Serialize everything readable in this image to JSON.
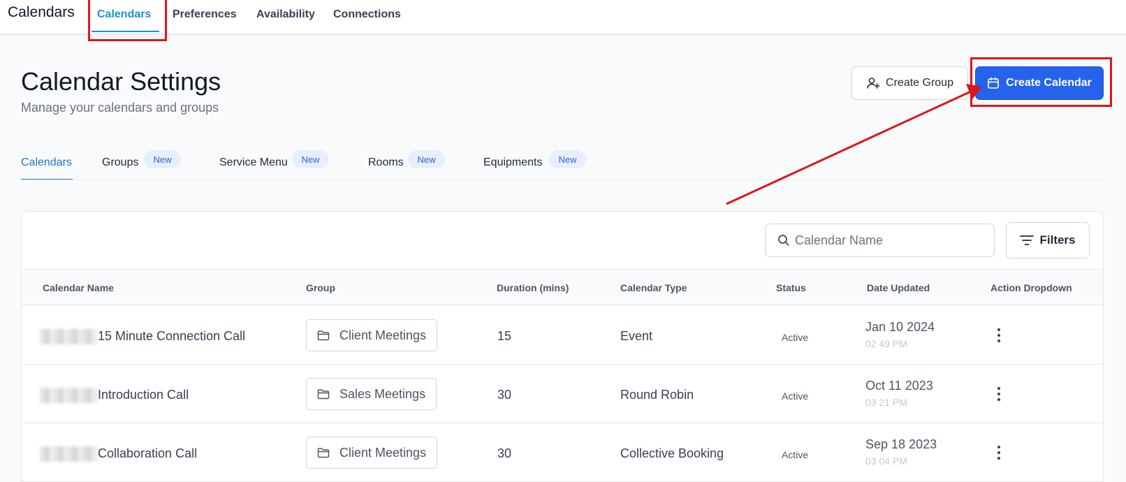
{
  "app": {
    "title": "Calendars"
  },
  "topnav": {
    "items": [
      {
        "label": "Calendars",
        "active": true
      },
      {
        "label": "Preferences"
      },
      {
        "label": "Availability"
      },
      {
        "label": "Connections"
      }
    ]
  },
  "header": {
    "title": "Calendar Settings",
    "subtitle": "Manage your calendars and groups",
    "create_group_label": "Create Group",
    "create_calendar_label": "Create Calendar"
  },
  "tabs": [
    {
      "label": "Calendars",
      "active": true
    },
    {
      "label": "Groups",
      "badge": "New"
    },
    {
      "label": "Service Menu",
      "badge": "New"
    },
    {
      "label": "Rooms",
      "badge": "New"
    },
    {
      "label": "Equipments",
      "badge": "New"
    }
  ],
  "search": {
    "placeholder": "Calendar Name"
  },
  "filters_label": "Filters",
  "table": {
    "columns": [
      "Calendar Name",
      "Group",
      "Duration (mins)",
      "Calendar Type",
      "Status",
      "Date Updated",
      "Action Dropdown"
    ],
    "rows": [
      {
        "name": "15 Minute Connection Call",
        "group": "Client Meetings",
        "duration": "15",
        "type": "Event",
        "status": "Active",
        "date": "Jan 10 2024",
        "time": "02 49 PM"
      },
      {
        "name": "Introduction Call",
        "group": "Sales Meetings",
        "duration": "30",
        "type": "Round Robin",
        "status": "Active",
        "date": "Oct 11 2023",
        "time": "03 21 PM"
      },
      {
        "name": "Collaboration Call",
        "group": "Client Meetings",
        "duration": "30",
        "type": "Collective Booking",
        "status": "Active",
        "date": "Sep 18 2023",
        "time": "03 04 PM"
      }
    ]
  },
  "colors": {
    "accent": "#2563eb",
    "annotation": "#e0141b",
    "active_tab": "#1e90d8"
  },
  "icons": {
    "create_group": "user-plus-icon",
    "create_calendar": "calendar-icon",
    "search": "search-icon",
    "filters": "filter-icon",
    "group": "folder-icon",
    "action": "kebab-menu-icon"
  }
}
